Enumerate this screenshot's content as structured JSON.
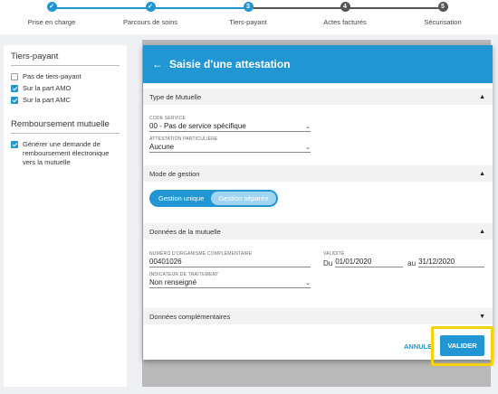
{
  "stepper": {
    "steps": [
      {
        "label": "Prise en charge",
        "marker": "✓",
        "state": "done"
      },
      {
        "label": "Parcours de soins",
        "marker": "✓",
        "state": "done"
      },
      {
        "label": "Tiers-payant",
        "marker": "3",
        "state": "current"
      },
      {
        "label": "Actes facturés",
        "marker": "4",
        "state": "todo"
      },
      {
        "label": "Sécurisation",
        "marker": "5",
        "state": "todo"
      }
    ]
  },
  "left_panel": {
    "tiers_payant": {
      "title": "Tiers-payant",
      "options": [
        {
          "label": "Pas de tiers-payant",
          "checked": false
        },
        {
          "label": "Sur la part AMO",
          "checked": true
        },
        {
          "label": "Sur la part AMC",
          "checked": true
        }
      ]
    },
    "remboursement": {
      "title": "Remboursement mutuelle",
      "option": {
        "label": "Générer une demande de remboursement électronique vers la mutuelle",
        "checked": true
      }
    }
  },
  "modal": {
    "back_icon": "arrow-left-icon",
    "title": "Saisie d'une attestation",
    "sections": {
      "type_mutuelle": {
        "title": "Type de Mutuelle",
        "code_service_label": "CODE SERVICE",
        "code_service_value": "00 - Pas de service spécifique",
        "attestation_label": "ATTESTATION PARTICULIÈRE",
        "attestation_value": "Aucune"
      },
      "mode_gestion": {
        "title": "Mode de gestion",
        "option_unique": "Gestion unique",
        "option_separee": "Gestion séparée",
        "selected": "Gestion séparée"
      },
      "donnees_mutuelle": {
        "title": "Données de la mutuelle",
        "numero_label": "NUMÉRO D'ORGANISME COMPLÉMENTAIRE",
        "numero_value": "00401026",
        "validite_label": "VALIDITÉ",
        "du_label": "Du",
        "du_value": "01/01/2020",
        "au_label": "au",
        "au_value": "31/12/2020",
        "indicateur_label": "INDICATEUR DE TRAITEMENT",
        "indicateur_value": "Non renseigné"
      },
      "donnees_complementaires": {
        "title": "Données complémentaires"
      }
    },
    "buttons": {
      "annuler": "ANNULE",
      "valider": "VALIDER"
    }
  },
  "colors": {
    "accent": "#2196d3",
    "highlight": "#f5d20c",
    "toggle_selected": "#9fd4f2",
    "step_todo": "#555555"
  }
}
